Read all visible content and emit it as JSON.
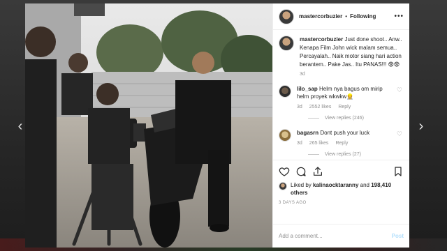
{
  "post": {
    "username": "mastercorbuzier",
    "separator": "•",
    "follow_label": "Following",
    "more_label": "•••",
    "caption": {
      "username": "mastercorbuzier",
      "text": "Just done shoot.. Anw.. Kenapa Film John wick malam semua.. Percayalah.. Naik motor siang hari action berantem.. Pake Jas.. Itu PANAS!!! 😨😨",
      "age": "3d"
    },
    "comments": [
      {
        "username": "lilo_sap",
        "text": "Helm nya bagus om mirip helm proyek wkwkw👷",
        "age": "3d",
        "likes": "2552 likes",
        "reply_label": "Reply",
        "view_replies": "View replies (246)"
      },
      {
        "username": "bagasrn",
        "text": "Dont push your luck",
        "age": "3d",
        "likes": "265 likes",
        "reply_label": "Reply",
        "view_replies": "View replies (27)"
      }
    ],
    "liked_by": {
      "prefix": "Liked by",
      "user": "kalinaocktaranny",
      "and": "and",
      "count": "198,410 others"
    },
    "date": "3 DAYS AGO",
    "add_comment_placeholder": "Add a comment...",
    "post_label": "Post"
  },
  "nav": {
    "prev": "‹",
    "next": "›"
  },
  "colors": {
    "link_blue": "#b2dffc",
    "text": "#262626",
    "muted": "#8e8e8e"
  }
}
